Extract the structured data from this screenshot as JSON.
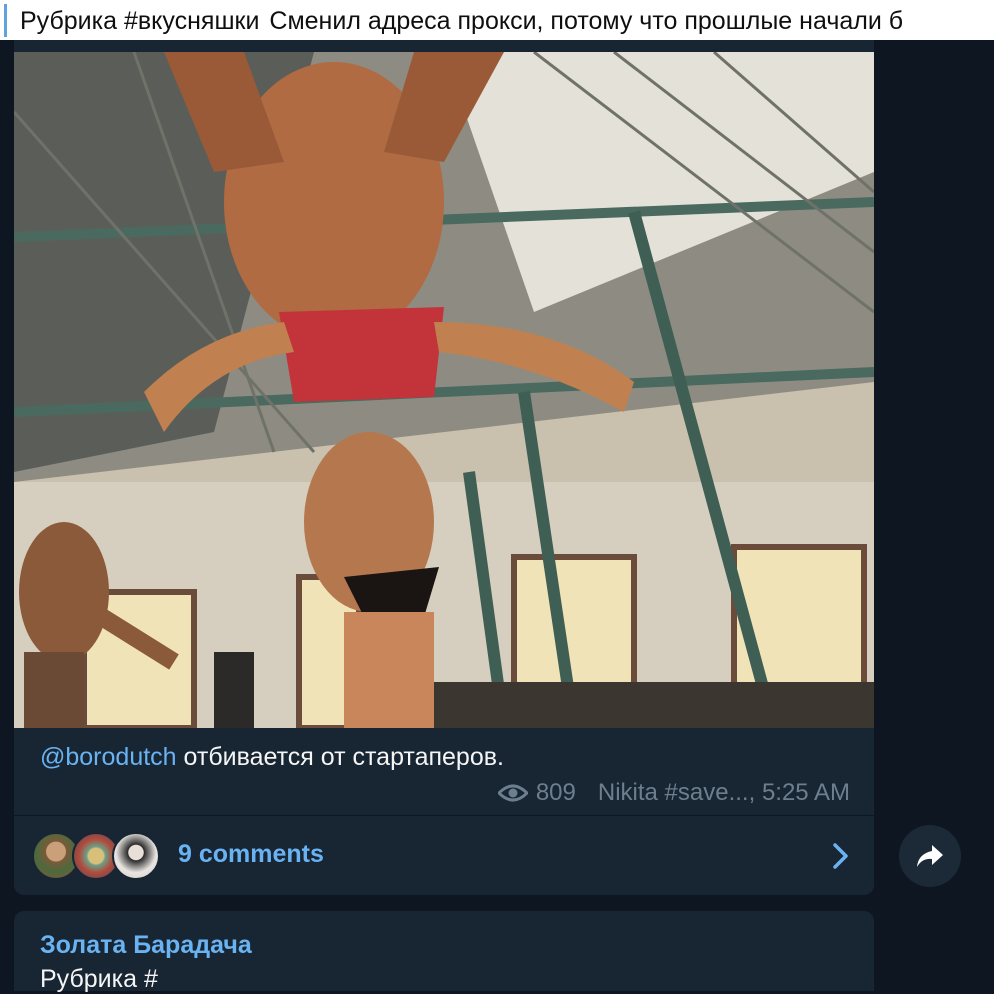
{
  "header": {
    "tag": "Рубрика #вкусняшки",
    "message": "Сменил адреса прокси, потому что прошлые начали б"
  },
  "post": {
    "media_alt_icon": "video-frame",
    "caption_mention": "@borodutch",
    "caption_text": " отбивается от стартаперов.",
    "views": "809",
    "author_time": "Nikita #save..., 5:25 AM"
  },
  "comments": {
    "label": "9 comments"
  },
  "next_post": {
    "author": "Золата Барадача",
    "preview": "Рубрика #"
  },
  "colors": {
    "background": "#0e1621",
    "bubble": "#182533",
    "link": "#6ab3f3",
    "meta": "#6d7f8f"
  }
}
